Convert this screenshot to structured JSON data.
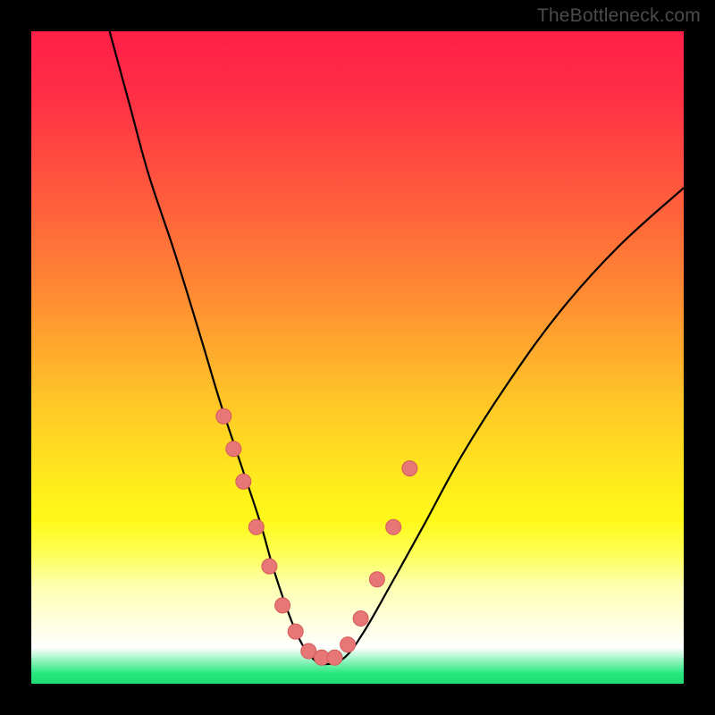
{
  "watermark": "TheBottleneck.com",
  "colors": {
    "black": "#000000",
    "curve": "#000000",
    "marker_fill": "#e77676",
    "marker_stroke": "#d65a5a",
    "gradient_stops": [
      {
        "offset": 0.0,
        "color": "#ff1f49"
      },
      {
        "offset": 0.1,
        "color": "#ff2f45"
      },
      {
        "offset": 0.25,
        "color": "#ff5a3d"
      },
      {
        "offset": 0.4,
        "color": "#ff8a33"
      },
      {
        "offset": 0.55,
        "color": "#ffc028"
      },
      {
        "offset": 0.68,
        "color": "#ffe81e"
      },
      {
        "offset": 0.75,
        "color": "#fff919"
      },
      {
        "offset": 0.8,
        "color": "#fdff55"
      },
      {
        "offset": 0.85,
        "color": "#fdffb0"
      },
      {
        "offset": 0.945,
        "color": "#ffffff"
      },
      {
        "offset": 0.985,
        "color": "#22e77c"
      },
      {
        "offset": 1.0,
        "color": "#1fdc74"
      }
    ]
  },
  "chart_data": {
    "type": "line",
    "title": "",
    "xlabel": "",
    "ylabel": "",
    "xlim": [
      0,
      100
    ],
    "ylim": [
      0,
      100
    ],
    "series": [
      {
        "name": "bottleneck-curve",
        "x": [
          12,
          15,
          18,
          22,
          26,
          29,
          32,
          35,
          37,
          39,
          41,
          43,
          45,
          48,
          51,
          55,
          60,
          66,
          73,
          81,
          90,
          100
        ],
        "y": [
          100,
          89,
          78,
          66,
          53,
          43,
          34,
          25,
          18,
          12,
          7,
          4,
          3,
          4,
          8,
          15,
          24,
          35,
          46,
          57,
          67,
          76
        ]
      }
    ],
    "markers": {
      "name": "highlighted-points",
      "x": [
        29.5,
        31,
        32.5,
        34.5,
        36.5,
        38.5,
        40.5,
        42.5,
        44.5,
        46.5,
        48.5,
        50.5,
        53,
        55.5,
        58
      ],
      "y": [
        41,
        36,
        31,
        24,
        18,
        12,
        8,
        5,
        4,
        4,
        6,
        10,
        16,
        24,
        33
      ]
    },
    "annotations": []
  }
}
